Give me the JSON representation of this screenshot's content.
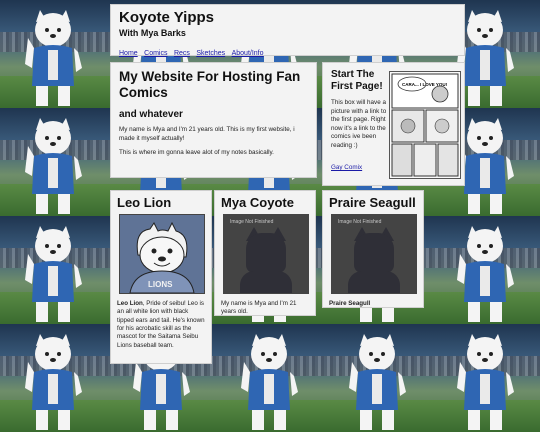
{
  "header": {
    "title": "Koyote Yipps",
    "subtitle": "With Mya Barks",
    "nav": [
      "Home",
      "Comics",
      "Recs",
      "Sketches",
      "About/Info"
    ]
  },
  "intro": {
    "title": "My Website For Hosting Fan Comics",
    "subtitle": "and whatever",
    "paragraphs": [
      "My name is Mya and I'm 21 years old. This is my first website, i made it myself actually!",
      "This is where im gonna leave alot of my notes basically."
    ]
  },
  "start": {
    "title": "Start The First Page!",
    "body": "This box will have a picture with a link to the first page. Right now it's a link to the comics ive been reading :)",
    "link": "Gay Comix",
    "comic_caption": "CARA... I LOVE YOU!"
  },
  "cards": {
    "leo": {
      "title": "Leo Lion",
      "name_bold": "Leo Lion",
      "text": ", Pride of seibu! Leo is an all white lion with black tipped ears and tail. He's known for his acrobatic skill as the mascot for the Saitama Seibu Lions baseball team.",
      "art_label": "LIONS"
    },
    "mya": {
      "title": "Mya Coyote",
      "text": "My name is Mya and I'm 21 years old.",
      "art_label": "Image Not Finished"
    },
    "seagull": {
      "title": "Praire Seagull",
      "text": "Praire Seagull",
      "art_label": "Image Not Finished"
    }
  },
  "colors": {
    "panel": "#f3f3f3",
    "link": "#1a1aa6",
    "leo_shirt": "#5f7396"
  }
}
